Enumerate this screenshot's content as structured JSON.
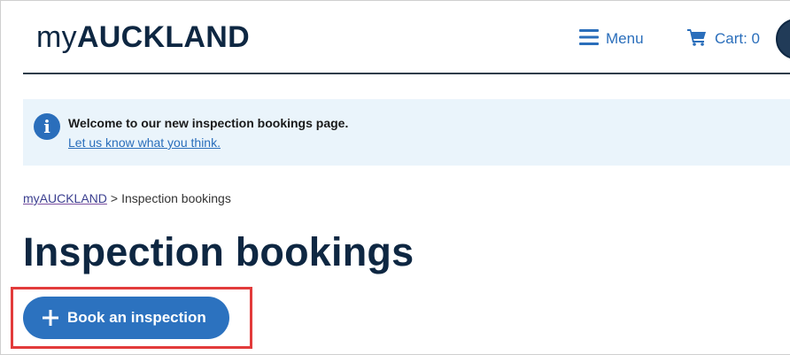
{
  "header": {
    "logo_prefix": "my",
    "logo_bold": "AUCKLAND",
    "menu_label": "Menu",
    "cart_label": "Cart: 0",
    "icons": {
      "menu": "hamburger-icon",
      "cart": "cart-icon"
    }
  },
  "banner": {
    "title": "Welcome to our new inspection bookings page.",
    "link": "Let us know what you think.",
    "icon": "info-icon",
    "icon_glyph": "i"
  },
  "breadcrumb": {
    "home": "myAUCKLAND",
    "separator": ">",
    "current": "Inspection bookings"
  },
  "page": {
    "title": "Inspection bookings"
  },
  "actions": {
    "book_label": "Book an inspection",
    "book_icon": "plus-icon"
  },
  "colors": {
    "brand_navy": "#0e2742",
    "link_blue": "#2a6ebb",
    "button_blue": "#2c72bf",
    "banner_bg": "#eaf4fb",
    "highlight_red": "#e23b3b"
  }
}
